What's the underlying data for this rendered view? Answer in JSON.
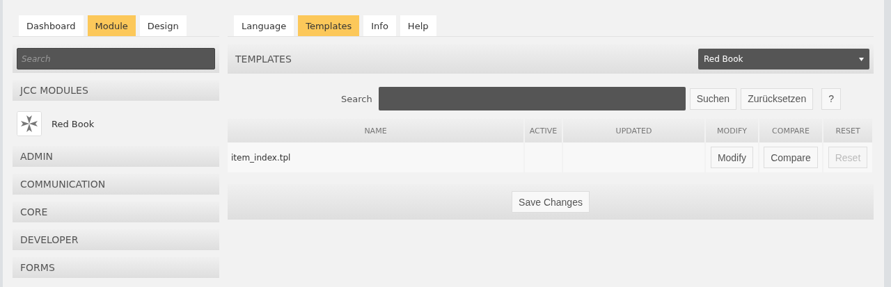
{
  "left_tabs": [
    {
      "label": "Dashboard",
      "selected": false
    },
    {
      "label": "Module",
      "selected": true
    },
    {
      "label": "Design",
      "selected": false
    }
  ],
  "right_tabs": [
    {
      "label": "Language",
      "selected": false
    },
    {
      "label": "Templates",
      "selected": true
    },
    {
      "label": "Info",
      "selected": false
    },
    {
      "label": "Help",
      "selected": false
    }
  ],
  "sidebar": {
    "search": {
      "placeholder": "Search"
    },
    "sections": [
      {
        "title": "JCC MODULES",
        "children": [
          {
            "label": "Red Book"
          }
        ]
      },
      {
        "title": "ADMIN"
      },
      {
        "title": "COMMUNICATION"
      },
      {
        "title": "CORE"
      },
      {
        "title": "DEVELOPER"
      },
      {
        "title": "FORMS"
      }
    ]
  },
  "main": {
    "title": "TEMPLATES",
    "module_select": {
      "value": "Red Book"
    },
    "search": {
      "label": "Search",
      "buttons": [
        "Suchen",
        "Zurücksetzen",
        "?"
      ]
    },
    "table": {
      "columns": [
        "NAME",
        "ACTIVE",
        "UPDATED",
        "MODIFY",
        "COMPARE",
        "RESET"
      ],
      "rows": [
        {
          "name": "item_index.tpl",
          "actions": [
            {
              "label": "Modify",
              "disabled": false
            },
            {
              "label": "Compare",
              "disabled": false
            },
            {
              "label": "Reset",
              "disabled": true
            }
          ]
        }
      ]
    },
    "save_button": "Save Changes"
  }
}
